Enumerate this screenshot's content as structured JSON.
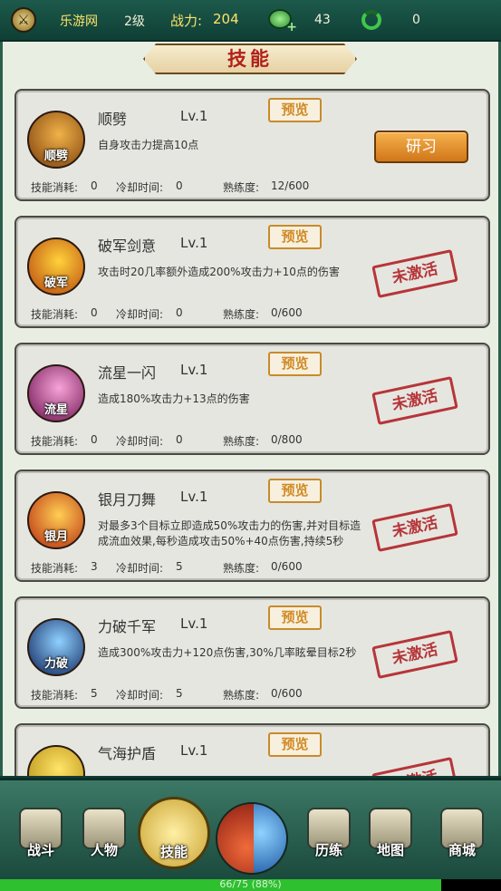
{
  "topbar": {
    "site": "乐游网",
    "level": "2级",
    "power_label": "战力:",
    "power_value": "204",
    "currency1_value": "43",
    "currency2_value": "0",
    "icons": [
      "logo-icon",
      "gem-plus-icon",
      "swirl-icon"
    ]
  },
  "panel": {
    "title": "技能"
  },
  "skills": [
    {
      "icon_text": "顺劈",
      "name": "顺劈",
      "level": "Lv.1",
      "desc": "自身攻击力提高10点",
      "preview": "预览",
      "cost_label": "技能消耗:",
      "cost": "0",
      "cooldown_label": "冷却时间:",
      "cooldown": "0",
      "proficiency_label": "熟练度:",
      "proficiency": "12/600",
      "action": "研习",
      "colors": [
        "#f0b248",
        "#7a3c0a"
      ]
    },
    {
      "icon_text": "破军",
      "name": "破军剑意",
      "level": "Lv.1",
      "desc": "攻击时20几率额外造成200%攻击力+10点的伤害",
      "preview": "预览",
      "cost_label": "技能消耗:",
      "cost": "0",
      "cooldown_label": "冷却时间:",
      "cooldown": "0",
      "proficiency_label": "熟练度:",
      "proficiency": "0/600",
      "status": "未激活",
      "colors": [
        "#ffd23a",
        "#b6420c"
      ]
    },
    {
      "icon_text": "流星",
      "name": "流星一闪",
      "level": "Lv.1",
      "desc": "造成180%攻击力+13点的伤害",
      "preview": "预览",
      "cost_label": "技能消耗:",
      "cost": "0",
      "cooldown_label": "冷却时间:",
      "cooldown": "0",
      "proficiency_label": "熟练度:",
      "proficiency": "0/800",
      "status": "未激活",
      "colors": [
        "#f7a3d8",
        "#6a0f4e"
      ]
    },
    {
      "icon_text": "银月",
      "name": "银月刀舞",
      "level": "Lv.1",
      "desc": "对最多3个目标立即造成50%攻击力的伤害,并对目标造成流血效果,每秒造成攻击50%+40点伤害,持续5秒",
      "preview": "预览",
      "cost_label": "技能消耗:",
      "cost": "3",
      "cooldown_label": "冷却时间:",
      "cooldown": "5",
      "proficiency_label": "熟练度:",
      "proficiency": "0/600",
      "status": "未激活",
      "colors": [
        "#ffce53",
        "#b5280f"
      ]
    },
    {
      "icon_text": "力破",
      "name": "力破千军",
      "level": "Lv.1",
      "desc": "造成300%攻击力+120点伤害,30%几率眩晕目标2秒",
      "preview": "预览",
      "cost_label": "技能消耗:",
      "cost": "5",
      "cooldown_label": "冷却时间:",
      "cooldown": "5",
      "proficiency_label": "熟练度:",
      "proficiency": "0/600",
      "status": "未激活",
      "colors": [
        "#8fd1ff",
        "#0b1f58"
      ]
    },
    {
      "icon_text": "",
      "name": "气海护盾",
      "level": "Lv.1",
      "desc": "",
      "preview": "预览",
      "cost_label": "",
      "cost": "",
      "cooldown_label": "",
      "cooldown": "",
      "proficiency_label": "",
      "proficiency": "",
      "status": "未激活",
      "colors": [
        "#ffe36a",
        "#b08a0a"
      ]
    }
  ],
  "nav": [
    {
      "label": "战斗",
      "icon": "pagoda-icon"
    },
    {
      "label": "人物",
      "icon": "character-icon"
    },
    {
      "label": "技能",
      "icon": "butterfly-icon"
    },
    {
      "label": "历练",
      "icon": "pillar-icon"
    },
    {
      "label": "地图",
      "icon": "scroll-map-icon"
    },
    {
      "label": "商城",
      "icon": "shop-icon"
    }
  ],
  "exp": {
    "text": "66/75 (88%)",
    "fraction": 0.88
  }
}
